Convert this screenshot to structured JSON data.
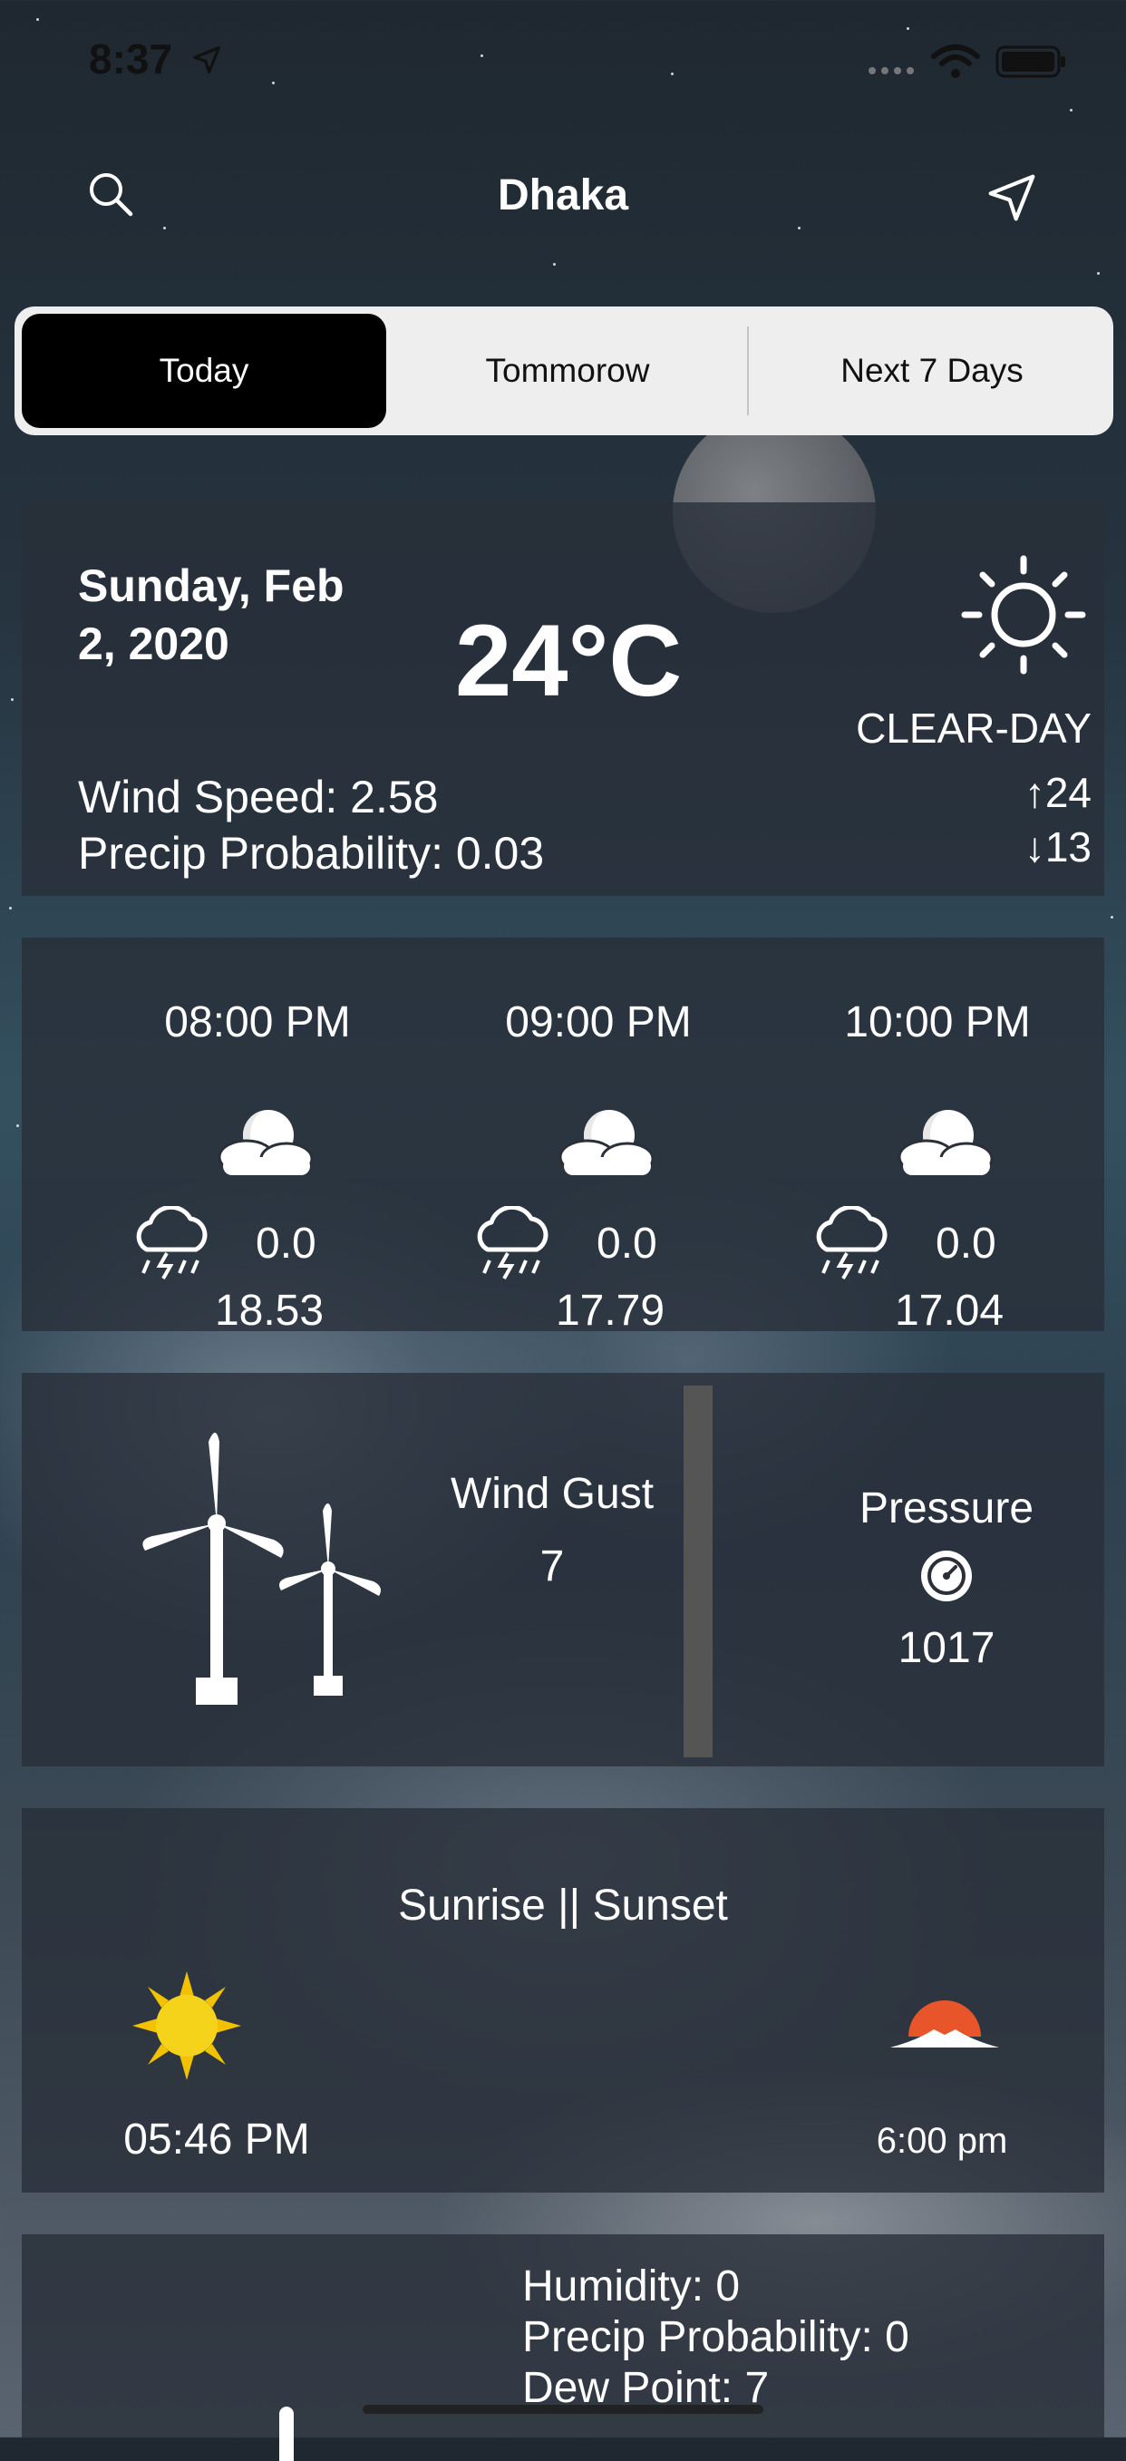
{
  "status_bar": {
    "time": "8:37"
  },
  "nav": {
    "title": "Dhaka",
    "search_icon": "search-icon",
    "location_icon": "location-arrow-icon"
  },
  "tabs": [
    {
      "label": "Today",
      "active": true
    },
    {
      "label": "Tommorow",
      "active": false
    },
    {
      "label": "Next 7 Days",
      "active": false
    }
  ],
  "today": {
    "date_line1": "Sunday, Feb",
    "date_line2": "2, 2020",
    "temperature": "24°C",
    "condition": "CLEAR-DAY",
    "high": "↑24",
    "low": "↓13",
    "wind_speed": "Wind Speed: 2.58",
    "precip_probability": "Precip Probability: 0.03",
    "icon": "sun-outline-icon"
  },
  "hourly": [
    {
      "time": "08:00 PM",
      "precip": "0.0",
      "temp": "18.53"
    },
    {
      "time": "09:00 PM",
      "precip": "0.0",
      "temp": "17.79"
    },
    {
      "time": "10:00 PM",
      "precip": "0.0",
      "temp": "17.04"
    }
  ],
  "wind": {
    "label": "Wind Gust",
    "value": "7"
  },
  "pressure": {
    "label": "Pressure",
    "value": "1017"
  },
  "sun": {
    "title": "Sunrise || Sunset",
    "sunrise": "05:46 PM",
    "sunset": "6:00 pm"
  },
  "details": {
    "humidity": "Humidity: 0",
    "precip_probability": "Precip Probability: 0",
    "dew_point": "Dew Point: 7"
  },
  "colors": {
    "card_bg": "#282e38",
    "tab_active": "#000000",
    "tab_bg": "#eeeeee"
  }
}
